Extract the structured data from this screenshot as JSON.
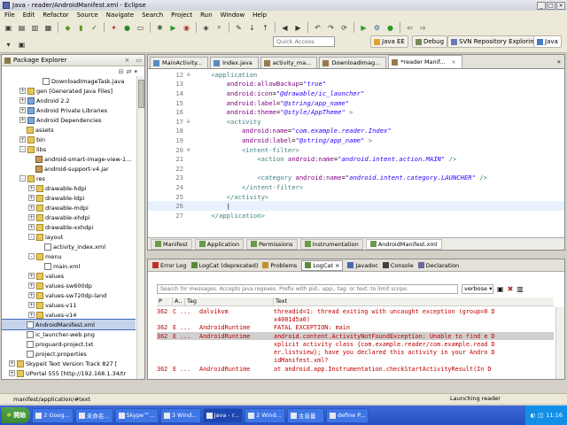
{
  "window": {
    "title": "Java - reader/AndroidManifest.xml - Eclipse"
  },
  "menu": [
    "File",
    "Edit",
    "Refactor",
    "Source",
    "Navigate",
    "Search",
    "Project",
    "Run",
    "Window",
    "Help"
  ],
  "toolbar": {
    "quick_access_placeholder": "Quick Access",
    "perspectives": [
      "Java EE",
      "Debug",
      "SVN Repository Exploring",
      "Java"
    ]
  },
  "package_explorer": {
    "title": "Package Explorer",
    "items": [
      {
        "label": "DownloadImageTask.java",
        "indent": 46,
        "icon": "file",
        "expander": ""
      },
      {
        "label": "gen [Generated Java Files]",
        "indent": 20,
        "icon": "folder",
        "expander": "+"
      },
      {
        "label": "Android 2.2",
        "indent": 20,
        "icon": "lib",
        "expander": "+"
      },
      {
        "label": "Android Private Libraries",
        "indent": 20,
        "icon": "lib",
        "expander": "+"
      },
      {
        "label": "Android Dependencies",
        "indent": 20,
        "icon": "lib",
        "expander": "+"
      },
      {
        "label": "assets",
        "indent": 28,
        "icon": "folder",
        "expander": ""
      },
      {
        "label": "bin",
        "indent": 20,
        "icon": "folder",
        "expander": "+"
      },
      {
        "label": "libs",
        "indent": 20,
        "icon": "folder",
        "expander": "-"
      },
      {
        "label": "android-smart-image-view-1...",
        "indent": 38,
        "icon": "jar",
        "expander": ""
      },
      {
        "label": "android-support-v4.jar",
        "indent": 38,
        "icon": "jar",
        "expander": ""
      },
      {
        "label": "res",
        "indent": 20,
        "icon": "folder",
        "expander": "-"
      },
      {
        "label": "drawable-hdpi",
        "indent": 30,
        "icon": "folder",
        "expander": "+"
      },
      {
        "label": "drawable-ldpi",
        "indent": 30,
        "icon": "folder",
        "expander": "+"
      },
      {
        "label": "drawable-mdpi",
        "indent": 30,
        "icon": "folder",
        "expander": "+"
      },
      {
        "label": "drawable-xhdpi",
        "indent": 30,
        "icon": "folder",
        "expander": "+"
      },
      {
        "label": "drawable-xxhdpi",
        "indent": 30,
        "icon": "folder",
        "expander": "+"
      },
      {
        "label": "layout",
        "indent": 30,
        "icon": "folder",
        "expander": "-"
      },
      {
        "label": "activity_index.xml",
        "indent": 48,
        "icon": "file",
        "expander": ""
      },
      {
        "label": "menu",
        "indent": 30,
        "icon": "folder",
        "expander": "-"
      },
      {
        "label": "main.xml",
        "indent": 48,
        "icon": "file",
        "expander": ""
      },
      {
        "label": "values",
        "indent": 30,
        "icon": "folder",
        "expander": "+"
      },
      {
        "label": "values-sw600dp",
        "indent": 30,
        "icon": "folder",
        "expander": "+"
      },
      {
        "label": "values-sw720dp-land",
        "indent": 30,
        "icon": "folder",
        "expander": "+"
      },
      {
        "label": "values-v11",
        "indent": 30,
        "icon": "folder",
        "expander": "+"
      },
      {
        "label": "values-v14",
        "indent": 30,
        "icon": "folder",
        "expander": "+"
      },
      {
        "label": "AndroidManifest.xml",
        "indent": 28,
        "icon": "file",
        "expander": "",
        "selected": true
      },
      {
        "label": "ic_launcher-web.png",
        "indent": 28,
        "icon": "file",
        "expander": ""
      },
      {
        "label": "proguard-project.txt",
        "indent": 28,
        "icon": "file",
        "expander": ""
      },
      {
        "label": "project.properties",
        "indent": 28,
        "icon": "file",
        "expander": ""
      },
      {
        "label": "Skypeit Text Version Track 827 [",
        "indent": 8,
        "icon": "folder",
        "expander": "+"
      },
      {
        "label": "UPortal 555 [http://192.168.1.34/tr",
        "indent": 8,
        "icon": "folder",
        "expander": "+"
      },
      {
        "label": "...",
        "indent": 8,
        "icon": "folder",
        "expander": "+"
      }
    ]
  },
  "editor": {
    "tabs": [
      {
        "label": "MainActivity...",
        "active": false
      },
      {
        "label": "Index.java",
        "active": false
      },
      {
        "label": "activity_ma...",
        "active": false
      },
      {
        "label": "DownloadImag...",
        "active": false
      },
      {
        "label": "*reader Manif...",
        "active": true
      }
    ],
    "bottom_tabs": [
      "Manifest",
      "Application",
      "Permissions",
      "Instrumentation",
      "AndroidManifest.xml"
    ],
    "lines": [
      {
        "n": "12",
        "fold": "⊖",
        "text": "    <application"
      },
      {
        "n": "13",
        "fold": "",
        "text": "        android:allowBackup=\"true\""
      },
      {
        "n": "14",
        "fold": "",
        "text": "        android:icon=\"@drawable/ic_launcher\""
      },
      {
        "n": "15",
        "fold": "",
        "text": "        android:label=\"@string/app_name\""
      },
      {
        "n": "16",
        "fold": "",
        "text": "        android:theme=\"@style/AppTheme\" >"
      },
      {
        "n": "17",
        "fold": "⊖",
        "text": "        <activity"
      },
      {
        "n": "18",
        "fold": "",
        "text": "            android:name=\"com.example.reader.Index\""
      },
      {
        "n": "19",
        "fold": "",
        "text": "            android:label=\"@string/app_name\" >"
      },
      {
        "n": "20",
        "fold": "⊖",
        "text": "            <intent-filter>"
      },
      {
        "n": "21",
        "fold": "",
        "text": "                <action android:name=\"android.intent.action.MAIN\" />"
      },
      {
        "n": "22",
        "fold": "",
        "text": ""
      },
      {
        "n": "23",
        "fold": "",
        "text": "                <category android:name=\"android.intent.category.LAUNCHER\" />"
      },
      {
        "n": "24",
        "fold": "",
        "text": "            </intent-filter>"
      },
      {
        "n": "25",
        "fold": "",
        "text": "        </activity>"
      },
      {
        "n": "26",
        "fold": "",
        "text": "        |",
        "current": true
      },
      {
        "n": "27",
        "fold": "",
        "text": "    </application>"
      }
    ]
  },
  "console": {
    "tabs": [
      "Error Log",
      "LogCat (deprecated)",
      "Problems",
      "LogCat",
      "Javadoc",
      "Console",
      "Declaration"
    ],
    "active_tab": "LogCat",
    "filter_placeholder": "Search for messages. Accepts Java regexes. Prefix with pid:, app:, tag: or text: to limit scope.",
    "verbosity": "verbose",
    "headers": [
      "P",
      "A..",
      "Tag",
      "Text"
    ],
    "rows": [
      {
        "pid": "362",
        "lvl": "C",
        "app": "...",
        "tag": "dalvikvm",
        "text": "threadid=1: thread exiting with uncaught exception (group=0 D",
        "hl": false
      },
      {
        "pid": "",
        "lvl": "",
        "app": "",
        "tag": "",
        "text": "x4001d5a0)",
        "hl": false
      },
      {
        "pid": "362",
        "lvl": "E",
        "app": "...",
        "tag": "AndroidRuntime",
        "text": "FATAL EXCEPTION: main",
        "hl": false
      },
      {
        "pid": "362",
        "lvl": "E",
        "app": "...",
        "tag": "AndroidRuntime",
        "text": "android.content.ActivityNotFoundException: Unable to find e D",
        "hl": true
      },
      {
        "pid": "",
        "lvl": "",
        "app": "",
        "tag": "",
        "text": "xplicit activity class {com.example.reader/com.example.read D",
        "hl": false
      },
      {
        "pid": "",
        "lvl": "",
        "app": "",
        "tag": "",
        "text": "er.listview}; have you declared this activity in your Andro D",
        "hl": false
      },
      {
        "pid": "",
        "lvl": "",
        "app": "",
        "tag": "",
        "text": "idManifest.xml?",
        "hl": false
      },
      {
        "pid": "362",
        "lvl": "E",
        "app": "...",
        "tag": "AndroidRuntime",
        "text": "at android.app.Instrumentation.checkStartActivityResult(In D",
        "hl": false
      }
    ]
  },
  "status": {
    "path": "manifest/application/#text",
    "launch": "Launching reader"
  },
  "taskbar": {
    "start": "開始",
    "items": [
      "2 Goog...",
      "未命名...",
      "Skype™...",
      "3 Wind...",
      "Java - r...",
      "2 Wind...",
      "主音量",
      "define P..."
    ],
    "active_index": 4,
    "clock": "11:16"
  },
  "colors": {
    "tag": "#3f7f7f",
    "attr": "#7f007f",
    "value": "#2a00ff",
    "log_error": "#c00000"
  }
}
